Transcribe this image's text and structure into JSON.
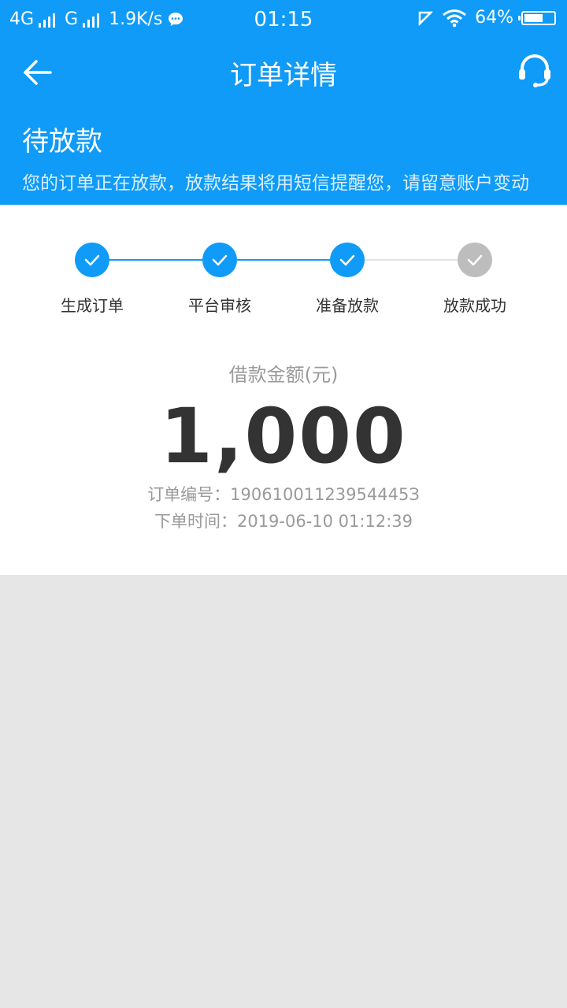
{
  "status_bar": {
    "network_1": "4G",
    "network_2": "G",
    "speed": "1.9K/s",
    "time": "01:15",
    "battery": "64%",
    "battery_level": 0.64
  },
  "nav": {
    "title": "订单详情"
  },
  "order_status": {
    "title": "待放款",
    "description": "您的订单正在放款，放款结果将用短信提醒您，请留意账户变动"
  },
  "steps": [
    {
      "label": "生成订单",
      "done": true
    },
    {
      "label": "平台审核",
      "done": true
    },
    {
      "label": "准备放款",
      "done": true
    },
    {
      "label": "放款成功",
      "done": false
    }
  ],
  "loan": {
    "amount_label": "借款金额(元)",
    "amount": "1,000",
    "order_no": "订单编号：19061001123954445З",
    "order_time": "下单时间：2019-06-10 01:12:39"
  },
  "colors": {
    "primary": "#0f9bf7",
    "step_done": "#0f9bf7",
    "step_pending": "#bdbdbd",
    "page_bg": "#e6e6e6"
  }
}
